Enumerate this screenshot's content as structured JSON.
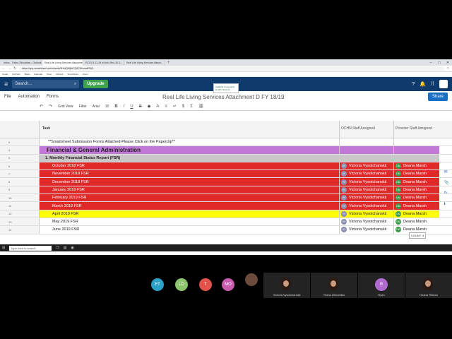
{
  "browser": {
    "tabs": [
      "Inbox - Trisha Zitiouridas - Outlook",
      "Real Life Living Services Attachme...",
      "RCLS 8-11-19 nil Info-Rec-18 D...",
      "Real Life Living Services Attach..."
    ],
    "new_tab": "+",
    "url": "https://app.smartsheet.com/sheets/9HrdQMj5xCQ9CWvmwfR5j3...",
    "bookmarks": [
      "Gmail",
      "YouTube",
      "Maps",
      "Calendar",
      "Drive",
      "Outlook",
      "Smartsheet",
      "Zoom"
    ]
  },
  "header": {
    "search_placeholder": "Search...",
    "upgrade_label": "Upgrade",
    "logo_text": "Oakland Community Health Network"
  },
  "menu": {
    "file": "File",
    "automation": "Automation",
    "forms": "Forms",
    "title": "Real Life Living Services Attachment D FY 18/19",
    "share": "Share"
  },
  "toolbar": {
    "view": "Grid View",
    "filter": "Filter",
    "font": "Arial",
    "size": "10"
  },
  "columns": {
    "task": "Task",
    "ochn": "OCHN Staff Assigned",
    "provider": "Provider Staff Assigned"
  },
  "rows": [
    {
      "num": "5",
      "task": "**Smartsheet Submission Forms Attached-Please Click on the Paperclip**",
      "ochn": "",
      "prov": ""
    },
    {
      "num": "4",
      "task": "Financial & General Administration",
      "ochn": "",
      "prov": ""
    },
    {
      "num": "5",
      "task": "1. Monthly Financial Status Report (FSR)",
      "ochn": "",
      "prov": ""
    },
    {
      "num": "6",
      "task": "October 2018 FSR",
      "ochn": "Victoria Vysotchanskii",
      "prov": "Deana Marsh"
    },
    {
      "num": "7",
      "task": "November 2018 FSR",
      "ochn": "Victoria Vysotchanskii",
      "prov": "Deana Marsh"
    },
    {
      "num": "8",
      "task": "December 2018 FSR",
      "ochn": "Victoria Vysotchanskii",
      "prov": "Deana Marsh"
    },
    {
      "num": "9",
      "task": "January 2019 FSR",
      "ochn": "Victoria Vysotchanskii",
      "prov": "Deana Marsh"
    },
    {
      "num": "10",
      "task": "February 2019 FSR",
      "ochn": "Victoria Vysotchanskii",
      "prov": "Deana Marsh"
    },
    {
      "num": "11",
      "task": "March 2019 FSR",
      "ochn": "Victoria Vysotchanskii",
      "prov": "Deana Marsh"
    },
    {
      "num": "12",
      "task": "April 2019 FSR",
      "ochn": "Victoria Vysotchanskii",
      "prov": "Deana Marsh"
    },
    {
      "num": "13",
      "task": "May 2019 FSR",
      "ochn": "Victoria Vysotchanskii",
      "prov": "Deana Marsh"
    },
    {
      "num": "14",
      "task": "June 2019 FSR",
      "ochn": "Victoria Vysotchanskii",
      "prov": "Deana Marsh"
    }
  ],
  "initials": {
    "vv": "VV",
    "dm": "DM"
  },
  "count_pill": "COUNT: 3",
  "taskbar": {
    "search": "Type here to search"
  },
  "participants": [
    {
      "initials": "ET",
      "color": "#2aa0c8"
    },
    {
      "initials": "LD",
      "color": "#8cc46b"
    },
    {
      "initials": "T",
      "color": "#e0524a"
    },
    {
      "initials": "MO",
      "color": "#c85ab0"
    },
    {
      "initials": "B",
      "color": "#b06ad0"
    }
  ],
  "tiles": [
    "Victoria Vysotchanskii",
    "Trisha Zitiouridas",
    "Ryan",
    "Deana Tillman"
  ]
}
